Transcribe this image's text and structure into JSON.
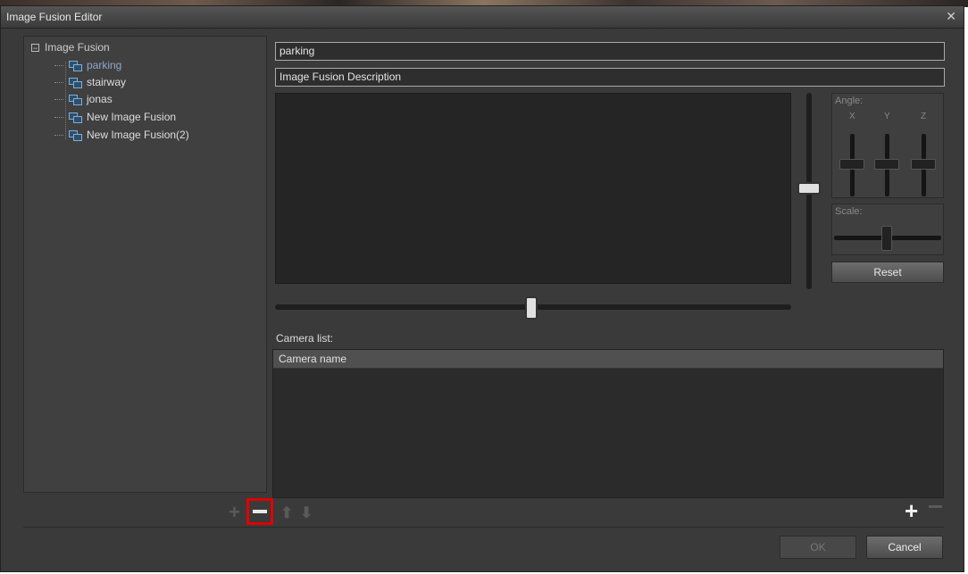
{
  "window": {
    "title": "Image Fusion Editor",
    "close_glyph": "✕"
  },
  "tree": {
    "root_expander": "−",
    "root_label": "Image Fusion",
    "items": [
      {
        "label": "parking",
        "selected": true
      },
      {
        "label": "stairway",
        "selected": false
      },
      {
        "label": "jonas",
        "selected": false
      },
      {
        "label": "New Image Fusion",
        "selected": false
      },
      {
        "label": "New Image Fusion(2)",
        "selected": false
      }
    ]
  },
  "editor": {
    "name_value": "parking",
    "description_value": "Image Fusion Description"
  },
  "angle": {
    "label": "Angle:",
    "x_label": "X",
    "y_label": "Y",
    "z_label": "Z"
  },
  "scale": {
    "label": "Scale:"
  },
  "reset_label": "Reset",
  "camera_list": {
    "label": "Camera list:",
    "column_header": "Camera name",
    "rows": []
  },
  "footer": {
    "ok_label": "OK",
    "cancel_label": "Cancel"
  },
  "icons": {
    "add": "plus-icon",
    "remove": "minus-icon",
    "up": "arrow-up-icon",
    "down": "arrow-down-icon",
    "highlight_color": "#e00000"
  }
}
